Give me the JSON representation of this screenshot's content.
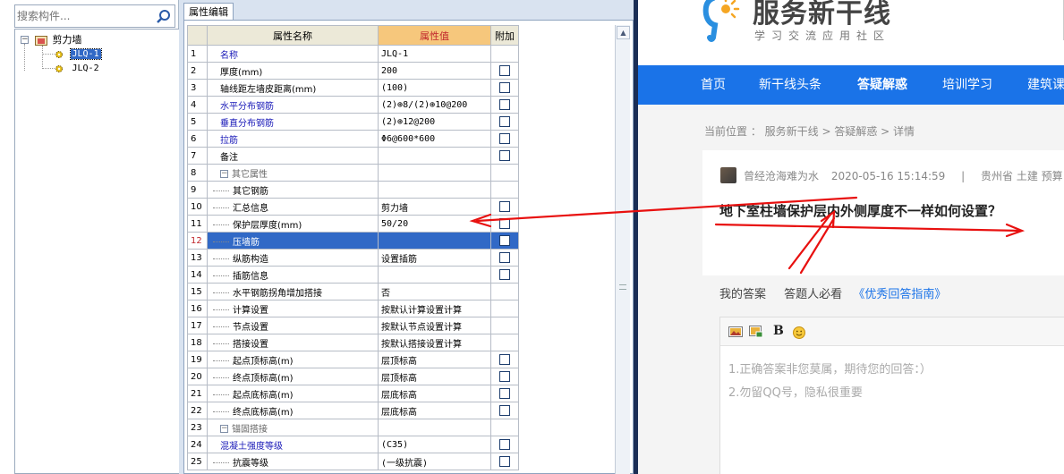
{
  "tree": {
    "search_placeholder": "搜索构件...",
    "root_label": "剪力墙",
    "items": [
      {
        "label": "JLQ-1",
        "selected": true
      },
      {
        "label": "JLQ-2",
        "selected": false
      }
    ]
  },
  "prop_editor": {
    "tab_label": "属性编辑",
    "headers": {
      "name": "属性名称",
      "value": "属性值",
      "extra": "附加"
    },
    "rows": [
      {
        "num": "1",
        "name": "名称",
        "value": "JLQ-1"
      },
      {
        "num": "2",
        "name": "厚度(mm)",
        "value": "200"
      },
      {
        "num": "3",
        "name": "轴线距左墙皮距离(mm)",
        "value": "(100)"
      },
      {
        "num": "4",
        "name": "水平分布钢筋",
        "value": "(2)⊕8/(2)⊕10@200"
      },
      {
        "num": "5",
        "name": "垂直分布钢筋",
        "value": "(2)⊕12@200"
      },
      {
        "num": "6",
        "name": "拉筋",
        "value": "Φ6@600*600"
      },
      {
        "num": "7",
        "name": "备注",
        "value": ""
      },
      {
        "num": "8",
        "name": "其它属性",
        "value": ""
      },
      {
        "num": "9",
        "name": "其它钢筋",
        "value": ""
      },
      {
        "num": "10",
        "name": "汇总信息",
        "value": "剪力墙"
      },
      {
        "num": "11",
        "name": "保护层厚度(mm)",
        "value": "50/20"
      },
      {
        "num": "12",
        "name": "压墙筋",
        "value": ""
      },
      {
        "num": "13",
        "name": "纵筋构造",
        "value": "设置插筋"
      },
      {
        "num": "14",
        "name": "插筋信息",
        "value": ""
      },
      {
        "num": "15",
        "name": "水平钢筋拐角增加搭接",
        "value": "否"
      },
      {
        "num": "16",
        "name": "计算设置",
        "value": "按默认计算设置计算"
      },
      {
        "num": "17",
        "name": "节点设置",
        "value": "按默认节点设置计算"
      },
      {
        "num": "18",
        "name": "搭接设置",
        "value": "按默认搭接设置计算"
      },
      {
        "num": "19",
        "name": "起点顶标高(m)",
        "value": "层顶标高"
      },
      {
        "num": "20",
        "name": "终点顶标高(m)",
        "value": "层顶标高"
      },
      {
        "num": "21",
        "name": "起点底标高(m)",
        "value": "层底标高"
      },
      {
        "num": "22",
        "name": "终点底标高(m)",
        "value": "层底标高"
      },
      {
        "num": "23",
        "name": "锚固搭接",
        "value": ""
      },
      {
        "num": "24",
        "name": "混凝土强度等级",
        "value": "(C35)"
      },
      {
        "num": "25",
        "name": "抗震等级",
        "value": "(一级抗震)"
      }
    ]
  },
  "web": {
    "site_name": "服务新干线",
    "slogan": "学习交流应用社区",
    "nav": [
      "首页",
      "新干线头条",
      "答疑解惑",
      "培训学习",
      "建筑课"
    ],
    "breadcrumb": "当前位置 ： 服务新干线 > 答疑解惑 > 详情",
    "asker": "曾经沧海难为水",
    "timestamp": "2020-05-16 15:14:59",
    "separator": "|",
    "region_tags": "贵州省  土建 预算 ...",
    "question_title": "地下室柱墙保护层内外侧厚度不一样如何设置？",
    "answer_label": "我的答案",
    "answer_must_read": "答题人必看",
    "answer_guide_link": "《优秀回答指南》",
    "bold_label": "B",
    "placeholder_line1": "1.正确答案非您莫属，期待您的回答：）",
    "placeholder_line2": "2.勿留QQ号，隐私很重要"
  },
  "colors": {
    "nav_blue": "#1a73e8",
    "selection_blue": "#3169c6",
    "annotation_red": "#e8100f",
    "value_header": "#f6c77c"
  }
}
